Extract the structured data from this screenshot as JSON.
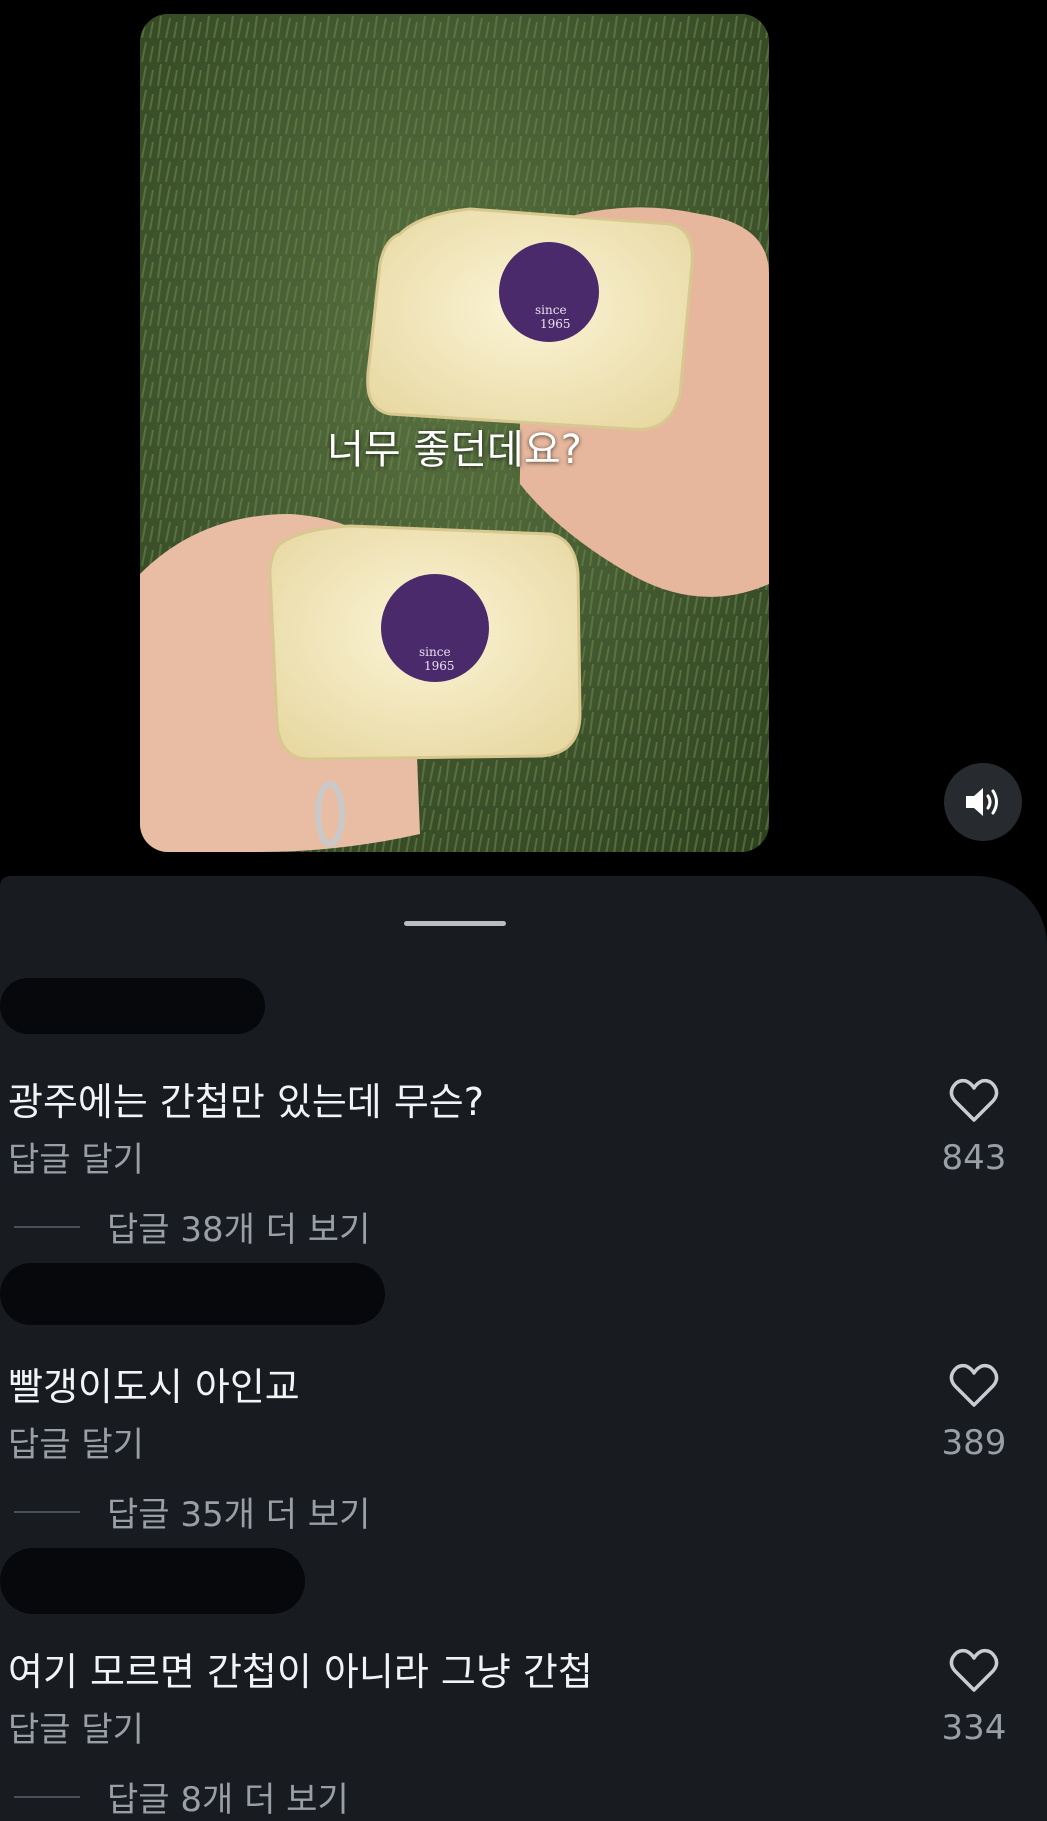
{
  "video": {
    "caption": "너무 좋던데요?",
    "sticker_year": "1965",
    "sticker_since": "since"
  },
  "controls": {
    "mute_icon": "speaker-icon"
  },
  "comments": [
    {
      "text": "광주에는 간첩만 있는데 무슨?",
      "reply_label": "답글 달기",
      "likes": "843",
      "view_replies": "답글 38개 더 보기"
    },
    {
      "text": "빨갱이도시 아인교",
      "reply_label": "답글 달기",
      "likes": "389",
      "view_replies": "답글 35개 더 보기"
    },
    {
      "text": "여기 모르면 간첩이 아니라 그냥 간첩",
      "reply_label": "답글 달기",
      "likes": "334",
      "view_replies": "답글 8개 더 보기"
    }
  ],
  "colors": {
    "background": "#000000",
    "sheet": "#181c21",
    "text": "#f2f3f5",
    "secondary_text": "#9a9ea5",
    "sticker": "#4a2a6a"
  }
}
